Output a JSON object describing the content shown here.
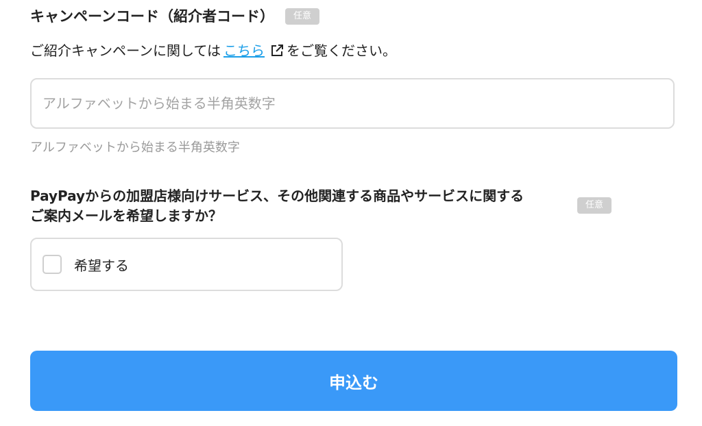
{
  "campaign": {
    "title": "キャンペーンコード（紹介者コード）",
    "badge": "任意",
    "desc_before": "ご紹介キャンペーンに関しては",
    "link_text": "こちら",
    "desc_after": "をご覧ください。",
    "input_placeholder": "アルファベットから始まる半角英数字",
    "input_value": "",
    "hint": "アルファベットから始まる半角英数字"
  },
  "mail_optin": {
    "question_line1": "PayPayからの加盟店様向けサービス、その他関連する商品やサービスに関する",
    "question_line2": "ご案内メールを希望しますか？",
    "badge": "任意",
    "checkbox_label": "希望する",
    "checked": false
  },
  "submit": {
    "label": "申込む"
  },
  "colors": {
    "accent": "#3a99f8",
    "link": "#1a9ee8",
    "badge_bg": "#cfcfcf"
  },
  "icons": {
    "external_link": "external-link-icon"
  }
}
